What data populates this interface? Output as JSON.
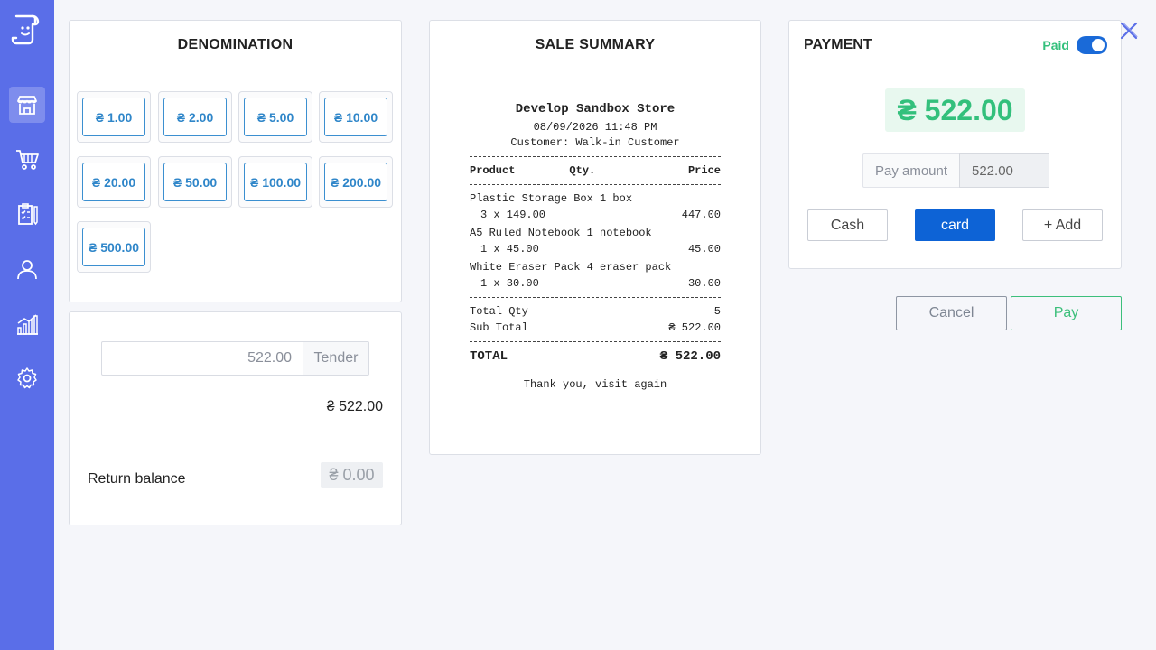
{
  "sidebar": {
    "items": [
      {
        "name": "store",
        "icon": "store-icon",
        "active": true
      },
      {
        "name": "cart",
        "icon": "cart-icon",
        "active": false
      },
      {
        "name": "orders",
        "icon": "clipboard-icon",
        "active": false
      },
      {
        "name": "customers",
        "icon": "user-icon",
        "active": false
      },
      {
        "name": "reports",
        "icon": "chart-icon",
        "active": false
      },
      {
        "name": "settings",
        "icon": "gear-icon",
        "active": false
      }
    ]
  },
  "denomination": {
    "title": "DENOMINATION",
    "buttons": [
      "₴ 1.00",
      "₴ 2.00",
      "₴ 5.00",
      "₴ 10.00",
      "₴ 20.00",
      "₴ 50.00",
      "₴ 100.00",
      "₴ 200.00",
      "₴ 500.00"
    ]
  },
  "tender": {
    "input_value": "522.00",
    "button_label": "Tender",
    "total": "₴ 522.00",
    "return_label": "Return balance",
    "return_value": "₴ 0.00"
  },
  "summary": {
    "title": "SALE SUMMARY",
    "store": "Develop Sandbox Store",
    "datetime": "08/09/2026 11:48 PM",
    "customer": "Customer: Walk-in Customer",
    "col_product": "Product",
    "col_qty": "Qty.",
    "col_price": "Price",
    "items": [
      {
        "name": "Plastic Storage Box 1 box",
        "qty": "3 x 149.00",
        "amount": "447.00"
      },
      {
        "name": "A5 Ruled Notebook 1 notebook",
        "qty": "1 x 45.00",
        "amount": "45.00"
      },
      {
        "name": "White Eraser Pack 4 eraser pack",
        "qty": "1 x 30.00",
        "amount": "30.00"
      }
    ],
    "total_qty_label": "Total Qty",
    "total_qty": "5",
    "subtotal_label": "Sub Total",
    "subtotal": "₴ 522.00",
    "total_label": "TOTAL",
    "total": "₴ 522.00",
    "footer": "Thank you, visit again"
  },
  "payment": {
    "title": "PAYMENT",
    "paid_label": "Paid",
    "amount": "₴ 522.00",
    "pay_amount_label": "Pay amount",
    "pay_amount_value": "522.00",
    "methods": [
      "Cash",
      "card"
    ],
    "active_method": "card",
    "add_label": "+ Add"
  },
  "actions": {
    "cancel": "Cancel",
    "pay": "Pay"
  },
  "colors": {
    "sidebar": "#5a6ee8",
    "accent_blue": "#0d63d6",
    "accent_green": "#33c07c"
  }
}
